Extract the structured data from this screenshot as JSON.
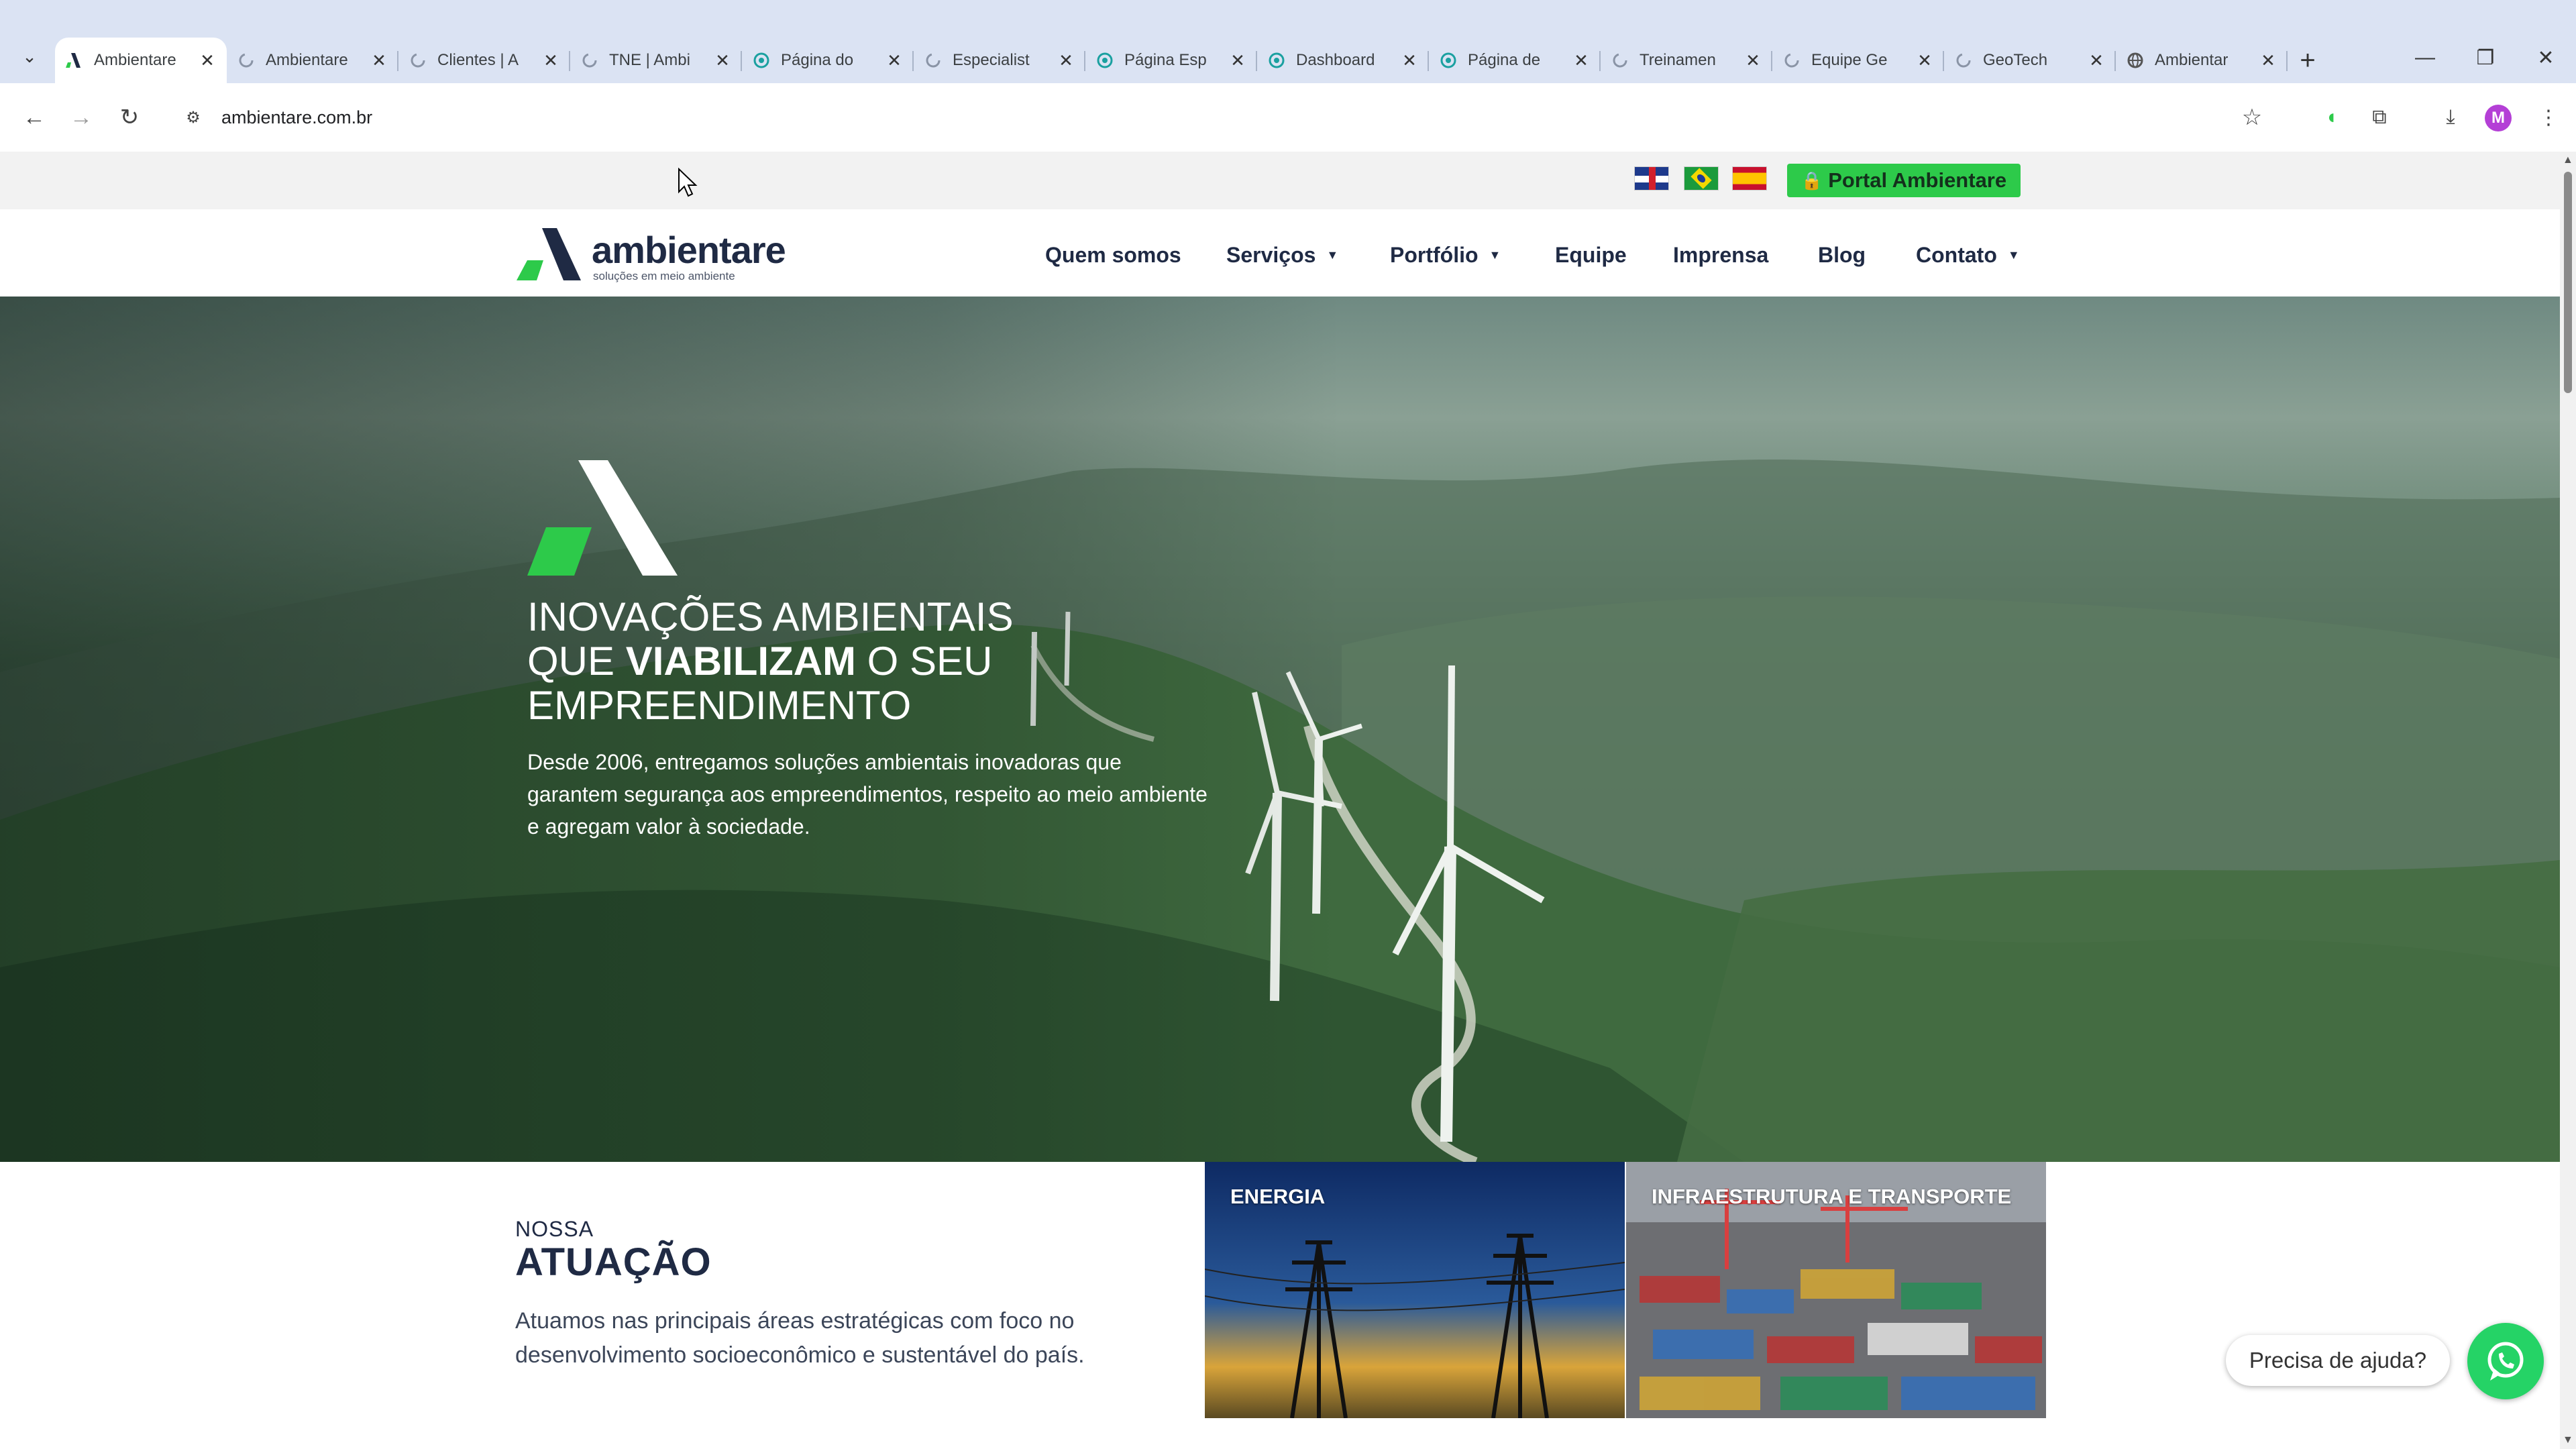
{
  "browser": {
    "tabs": [
      {
        "title": "Ambientare",
        "favicon": "ambientare-logo-icon",
        "active": true
      },
      {
        "title": "Ambientare",
        "favicon": "loading-icon"
      },
      {
        "title": "Clientes | A",
        "favicon": "loading-icon"
      },
      {
        "title": "TNE | Ambi",
        "favicon": "loading-icon"
      },
      {
        "title": "Página do",
        "favicon": "globe-icon"
      },
      {
        "title": "Especialist",
        "favicon": "loading-icon"
      },
      {
        "title": "Página Esp",
        "favicon": "globe-icon"
      },
      {
        "title": "Dashboard",
        "favicon": "globe-icon"
      },
      {
        "title": "Página de",
        "favicon": "globe-icon"
      },
      {
        "title": "Treinamen",
        "favicon": "loading-icon"
      },
      {
        "title": "Equipe Ge",
        "favicon": "loading-icon"
      },
      {
        "title": "GeoTech",
        "favicon": "loading-icon"
      },
      {
        "title": "Ambientar",
        "favicon": "globe-icon"
      }
    ],
    "close_glyph": "✕",
    "new_tab_glyph": "+",
    "url": "ambientare.com.br",
    "profile_initial": "M"
  },
  "topbar": {
    "languages": [
      "English",
      "Português",
      "Español"
    ],
    "portal_label": "Portal Ambientare",
    "portal_color": "#2dca4a"
  },
  "header": {
    "logo_brand": "ambientare",
    "logo_tagline": "soluções em meio ambiente",
    "nav": [
      {
        "label": "Quem somos",
        "dropdown": false
      },
      {
        "label": "Serviços",
        "dropdown": true
      },
      {
        "label": "Portfólio",
        "dropdown": true
      },
      {
        "label": "Equipe",
        "dropdown": false
      },
      {
        "label": "Imprensa",
        "dropdown": false
      },
      {
        "label": "Blog",
        "dropdown": false
      },
      {
        "label": "Contato",
        "dropdown": true
      }
    ]
  },
  "hero": {
    "heading_line1": "INOVAÇÕES AMBIENTAIS",
    "heading_line2_pre": "QUE ",
    "heading_line2_bold": "VIABILIZAM",
    "heading_line2_post": " O SEU",
    "heading_line3": "EMPREENDIMENTO",
    "subtitle": "Desde 2006, entregamos soluções ambientais inovadoras que garantem segurança aos empreendimentos, respeito ao meio ambiente e agregam valor à sociedade."
  },
  "atuacao": {
    "kicker": "NOSSA",
    "title": "ATUAÇÃO",
    "text": "Atuamos nas principais áreas estratégicas com foco no desenvolvimento socioeconômico e sustentável do país.",
    "cards": [
      {
        "label": "ENERGIA"
      },
      {
        "label": "INFRAESTRUTURA E TRANSPORTE"
      }
    ]
  },
  "chat": {
    "help_label": "Precisa de ajuda?"
  },
  "colors": {
    "brand_dark": "#1f2a44",
    "brand_green": "#2dca4a",
    "whatsapp": "#25d366"
  }
}
